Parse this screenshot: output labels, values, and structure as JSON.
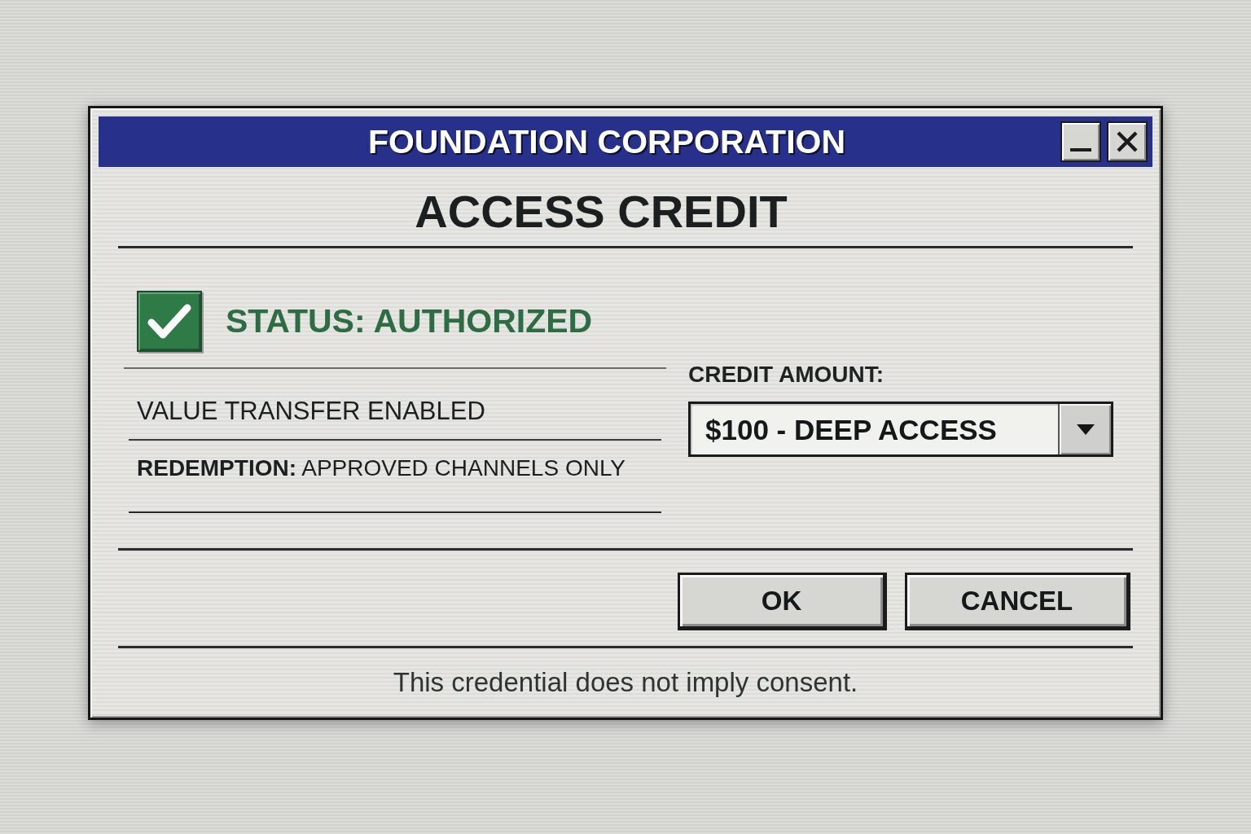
{
  "window": {
    "title": "FOUNDATION CORPORATION"
  },
  "heading": "ACCESS CREDIT",
  "status": {
    "checked": true,
    "label": "STATUS: AUTHORIZED"
  },
  "details": [
    "VALUE TRANSFER ENABLED",
    "**REDEMPTION:** APPROVED CHANNELS ONLY"
  ],
  "credit_amount": {
    "label": "CREDIT AMOUNT:",
    "value": "$100 - DEEP ACCESS"
  },
  "buttons": [
    "OK",
    "CANCEL"
  ],
  "footer": "This credential does not imply consent."
}
